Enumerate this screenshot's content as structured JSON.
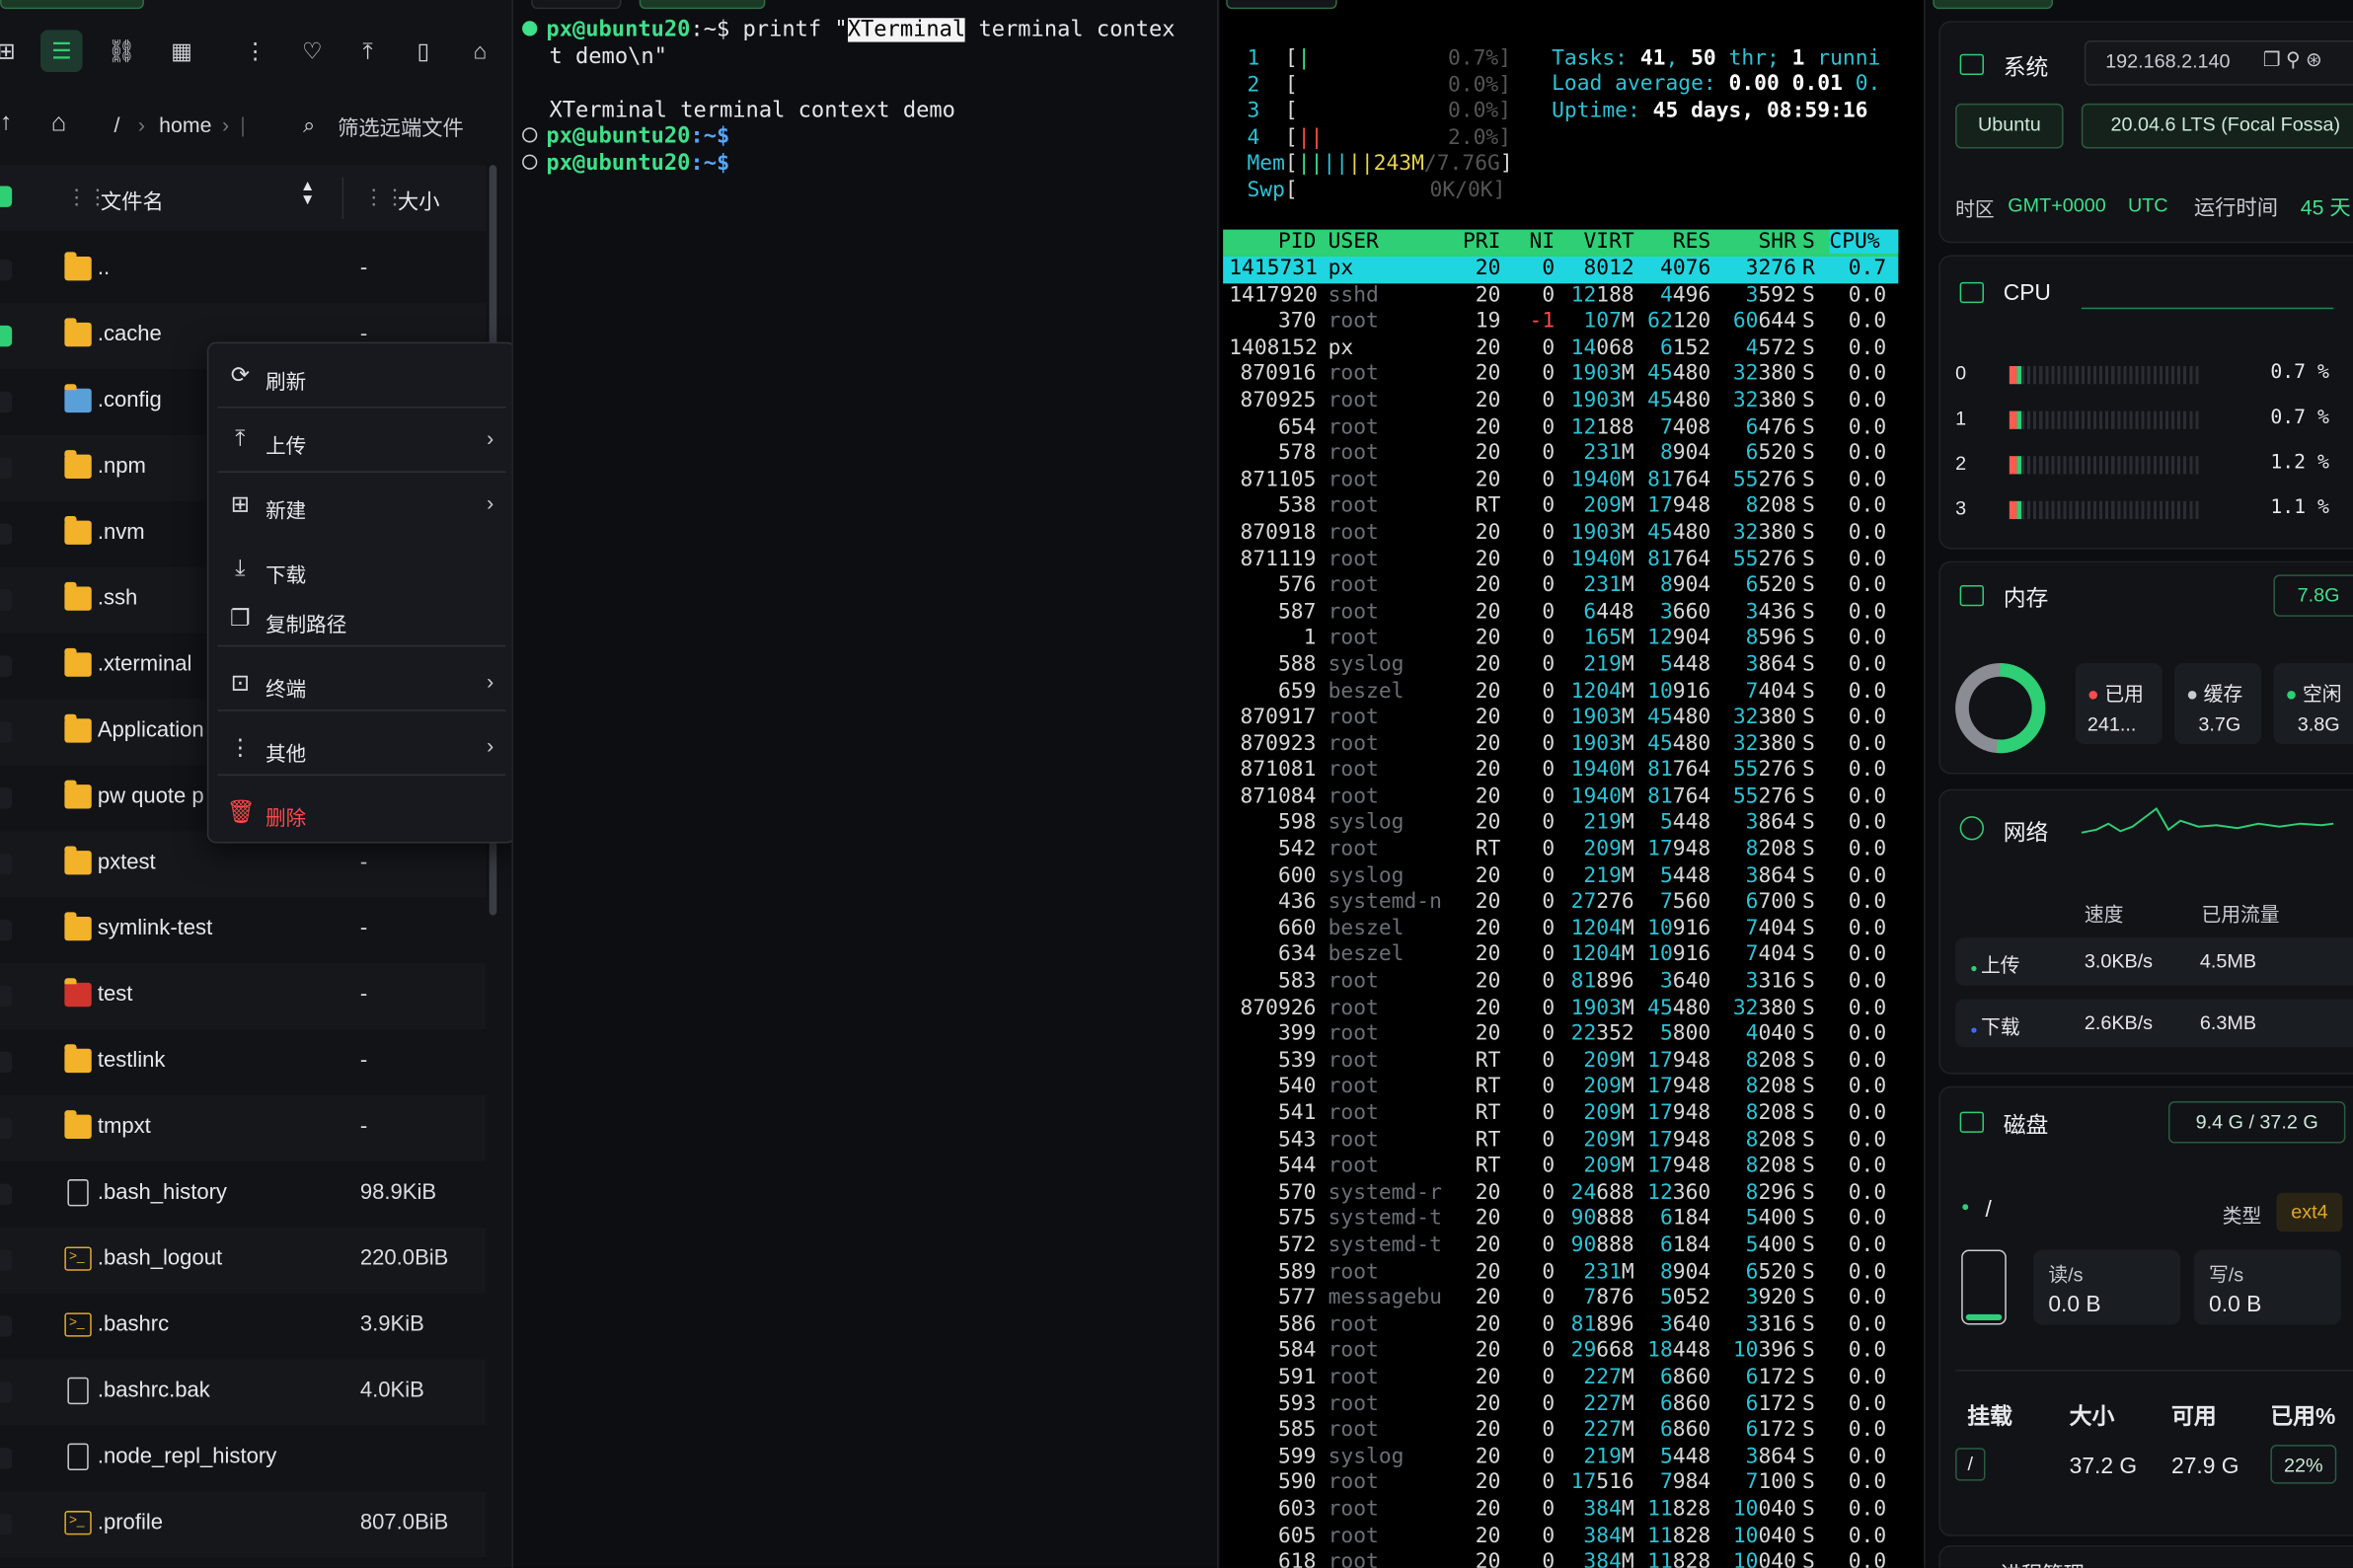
{
  "file_pane": {
    "path": {
      "sep": "/",
      "home": "home",
      "filter_placeholder": "筛选远端文件"
    },
    "columns": {
      "name": "文件名",
      "size": "大小"
    },
    "rows": [
      {
        "name": "..",
        "size": "-",
        "type": "folder",
        "checked": false
      },
      {
        "name": ".cache",
        "size": "-",
        "type": "folder",
        "checked": true
      },
      {
        "name": ".config",
        "size": "",
        "type": "gear-folder",
        "checked": false
      },
      {
        "name": ".npm",
        "size": "",
        "type": "folder",
        "checked": false
      },
      {
        "name": ".nvm",
        "size": "",
        "type": "folder",
        "checked": false
      },
      {
        "name": ".ssh",
        "size": "",
        "type": "folder",
        "checked": false
      },
      {
        "name": ".xterminal",
        "size": "",
        "type": "folder",
        "checked": false
      },
      {
        "name": "Application",
        "size": "",
        "type": "folder",
        "checked": false
      },
      {
        "name": "pw quote p",
        "size": "",
        "type": "folder",
        "checked": false
      },
      {
        "name": "pxtest",
        "size": "-",
        "type": "folder",
        "checked": false
      },
      {
        "name": "symlink-test",
        "size": "-",
        "type": "folder",
        "checked": false
      },
      {
        "name": "test",
        "size": "-",
        "type": "special",
        "checked": false
      },
      {
        "name": "testlink",
        "size": "-",
        "type": "folder",
        "checked": false
      },
      {
        "name": "tmpxt",
        "size": "-",
        "type": "folder",
        "checked": false
      },
      {
        "name": ".bash_history",
        "size": "98.9KiB",
        "type": "file",
        "checked": false
      },
      {
        "name": ".bash_logout",
        "size": "220.0BiB",
        "type": "terminal",
        "checked": false
      },
      {
        "name": ".bashrc",
        "size": "3.9KiB",
        "type": "terminal",
        "checked": false
      },
      {
        "name": ".bashrc.bak",
        "size": "4.0KiB",
        "type": "file",
        "checked": false
      },
      {
        "name": ".node_repl_history",
        "size": "",
        "type": "file",
        "checked": false
      },
      {
        "name": ".profile",
        "size": "807.0BiB",
        "type": "terminal",
        "checked": false
      }
    ],
    "context_menu": [
      {
        "label": "刷新",
        "icon": "refresh-icon",
        "glyph": "⟳",
        "arrow": false
      },
      {
        "label": "上传",
        "icon": "upload-icon",
        "glyph": "⤒",
        "arrow": true
      },
      {
        "label": "新建",
        "icon": "new-file-icon",
        "glyph": "⊞",
        "arrow": true
      },
      {
        "label": "下载",
        "icon": "download-icon",
        "glyph": "⤓",
        "arrow": false
      },
      {
        "label": "复制路径",
        "icon": "copy-icon",
        "glyph": "❐",
        "arrow": false
      },
      {
        "label": "终端",
        "icon": "terminal-icon",
        "glyph": "⊡",
        "arrow": true
      },
      {
        "label": "其他",
        "icon": "more-icon",
        "glyph": "⋮",
        "arrow": true
      },
      {
        "label": "删除",
        "icon": "trash-icon",
        "glyph": "🗑",
        "arrow": false,
        "danger": true
      }
    ]
  },
  "terminal": {
    "user": "px@ubuntu20",
    "cmd_line1_pre": ":~$ printf \"",
    "cmd_highlight": "XTerminal",
    "cmd_line1_post": " terminal contex",
    "cmd_line2": "t demo\\n\"",
    "output": "XTerminal terminal context demo",
    "prompt_tail": ":~$"
  },
  "htop": {
    "cpus": [
      {
        "n": "1",
        "bar": "|",
        "pct": "0.7%]"
      },
      {
        "n": "2",
        "bar": "",
        "pct": "0.0%]"
      },
      {
        "n": "3",
        "bar": "",
        "pct": "0.0%]"
      },
      {
        "n": "4",
        "bar": "||",
        "pct": "2.0%]"
      }
    ],
    "mem": "Mem[||||243M/7.76G]",
    "mem_used": "243M",
    "mem_total": "7.76G",
    "swp": "0K/0K]",
    "tasks_label": "Tasks: ",
    "tasks": "41",
    "thr_sep": ", ",
    "thr": "50",
    "thr_label": " thr; ",
    "running": "1",
    "running_label": " runni",
    "load_label": "Load average: ",
    "load1": "0.00",
    "load5": "0.01",
    "load15": "0.",
    "uptime_label": "Uptime: ",
    "uptime": "45 days, 08:59:16",
    "headers": [
      "PID",
      "USER",
      "PRI",
      "NI",
      "VIRT",
      "RES",
      "SHR",
      "S",
      "CPU%"
    ],
    "procs": [
      [
        "1415731",
        "px",
        "20",
        "0",
        "8012",
        "4076",
        "3276",
        "R",
        "0.7"
      ],
      [
        "1417920",
        "sshd",
        "20",
        "0",
        "12188",
        "4496",
        "3592",
        "S",
        "0.0"
      ],
      [
        "370",
        "root",
        "19",
        "-1",
        "107M",
        "62120",
        "60644",
        "S",
        "0.0"
      ],
      [
        "1408152",
        "px",
        "20",
        "0",
        "14068",
        "6152",
        "4572",
        "S",
        "0.0"
      ],
      [
        "870916",
        "root",
        "20",
        "0",
        "1903M",
        "45480",
        "32380",
        "S",
        "0.0"
      ],
      [
        "870925",
        "root",
        "20",
        "0",
        "1903M",
        "45480",
        "32380",
        "S",
        "0.0"
      ],
      [
        "654",
        "root",
        "20",
        "0",
        "12188",
        "7408",
        "6476",
        "S",
        "0.0"
      ],
      [
        "578",
        "root",
        "20",
        "0",
        "231M",
        "8904",
        "6520",
        "S",
        "0.0"
      ],
      [
        "871105",
        "root",
        "20",
        "0",
        "1940M",
        "81764",
        "55276",
        "S",
        "0.0"
      ],
      [
        "538",
        "root",
        "RT",
        "0",
        "209M",
        "17948",
        "8208",
        "S",
        "0.0"
      ],
      [
        "870918",
        "root",
        "20",
        "0",
        "1903M",
        "45480",
        "32380",
        "S",
        "0.0"
      ],
      [
        "871119",
        "root",
        "20",
        "0",
        "1940M",
        "81764",
        "55276",
        "S",
        "0.0"
      ],
      [
        "576",
        "root",
        "20",
        "0",
        "231M",
        "8904",
        "6520",
        "S",
        "0.0"
      ],
      [
        "587",
        "root",
        "20",
        "0",
        "6448",
        "3660",
        "3436",
        "S",
        "0.0"
      ],
      [
        "1",
        "root",
        "20",
        "0",
        "165M",
        "12904",
        "8596",
        "S",
        "0.0"
      ],
      [
        "588",
        "syslog",
        "20",
        "0",
        "219M",
        "5448",
        "3864",
        "S",
        "0.0"
      ],
      [
        "659",
        "beszel",
        "20",
        "0",
        "1204M",
        "10916",
        "7404",
        "S",
        "0.0"
      ],
      [
        "870917",
        "root",
        "20",
        "0",
        "1903M",
        "45480",
        "32380",
        "S",
        "0.0"
      ],
      [
        "870923",
        "root",
        "20",
        "0",
        "1903M",
        "45480",
        "32380",
        "S",
        "0.0"
      ],
      [
        "871081",
        "root",
        "20",
        "0",
        "1940M",
        "81764",
        "55276",
        "S",
        "0.0"
      ],
      [
        "871084",
        "root",
        "20",
        "0",
        "1940M",
        "81764",
        "55276",
        "S",
        "0.0"
      ],
      [
        "598",
        "syslog",
        "20",
        "0",
        "219M",
        "5448",
        "3864",
        "S",
        "0.0"
      ],
      [
        "542",
        "root",
        "RT",
        "0",
        "209M",
        "17948",
        "8208",
        "S",
        "0.0"
      ],
      [
        "600",
        "syslog",
        "20",
        "0",
        "219M",
        "5448",
        "3864",
        "S",
        "0.0"
      ],
      [
        "436",
        "systemd-n",
        "20",
        "0",
        "27276",
        "7560",
        "6700",
        "S",
        "0.0"
      ],
      [
        "660",
        "beszel",
        "20",
        "0",
        "1204M",
        "10916",
        "7404",
        "S",
        "0.0"
      ],
      [
        "634",
        "beszel",
        "20",
        "0",
        "1204M",
        "10916",
        "7404",
        "S",
        "0.0"
      ],
      [
        "583",
        "root",
        "20",
        "0",
        "81896",
        "3640",
        "3316",
        "S",
        "0.0"
      ],
      [
        "870926",
        "root",
        "20",
        "0",
        "1903M",
        "45480",
        "32380",
        "S",
        "0.0"
      ],
      [
        "399",
        "root",
        "20",
        "0",
        "22352",
        "5800",
        "4040",
        "S",
        "0.0"
      ],
      [
        "539",
        "root",
        "RT",
        "0",
        "209M",
        "17948",
        "8208",
        "S",
        "0.0"
      ],
      [
        "540",
        "root",
        "RT",
        "0",
        "209M",
        "17948",
        "8208",
        "S",
        "0.0"
      ],
      [
        "541",
        "root",
        "RT",
        "0",
        "209M",
        "17948",
        "8208",
        "S",
        "0.0"
      ],
      [
        "543",
        "root",
        "RT",
        "0",
        "209M",
        "17948",
        "8208",
        "S",
        "0.0"
      ],
      [
        "544",
        "root",
        "RT",
        "0",
        "209M",
        "17948",
        "8208",
        "S",
        "0.0"
      ],
      [
        "570",
        "systemd-r",
        "20",
        "0",
        "24688",
        "12360",
        "8296",
        "S",
        "0.0"
      ],
      [
        "575",
        "systemd-t",
        "20",
        "0",
        "90888",
        "6184",
        "5400",
        "S",
        "0.0"
      ],
      [
        "572",
        "systemd-t",
        "20",
        "0",
        "90888",
        "6184",
        "5400",
        "S",
        "0.0"
      ],
      [
        "589",
        "root",
        "20",
        "0",
        "231M",
        "8904",
        "6520",
        "S",
        "0.0"
      ],
      [
        "577",
        "messagebu",
        "20",
        "0",
        "7876",
        "5052",
        "3920",
        "S",
        "0.0"
      ],
      [
        "586",
        "root",
        "20",
        "0",
        "81896",
        "3640",
        "3316",
        "S",
        "0.0"
      ],
      [
        "584",
        "root",
        "20",
        "0",
        "29668",
        "18448",
        "10396",
        "S",
        "0.0"
      ],
      [
        "591",
        "root",
        "20",
        "0",
        "227M",
        "6860",
        "6172",
        "S",
        "0.0"
      ],
      [
        "593",
        "root",
        "20",
        "0",
        "227M",
        "6860",
        "6172",
        "S",
        "0.0"
      ],
      [
        "585",
        "root",
        "20",
        "0",
        "227M",
        "6860",
        "6172",
        "S",
        "0.0"
      ],
      [
        "599",
        "syslog",
        "20",
        "0",
        "219M",
        "5448",
        "3864",
        "S",
        "0.0"
      ],
      [
        "590",
        "root",
        "20",
        "0",
        "17516",
        "7984",
        "7100",
        "S",
        "0.0"
      ],
      [
        "603",
        "root",
        "20",
        "0",
        "384M",
        "11828",
        "10040",
        "S",
        "0.0"
      ],
      [
        "605",
        "root",
        "20",
        "0",
        "384M",
        "11828",
        "10040",
        "S",
        "0.0"
      ],
      [
        "618",
        "root",
        "20",
        "0",
        "384M",
        "11828",
        "10040",
        "S",
        "0.0"
      ]
    ]
  },
  "monitor": {
    "system": {
      "title": "系统",
      "ip": "192.168.2.140",
      "os": "Ubuntu",
      "version": "20.04.6 LTS (Focal Fossa)",
      "tz_label": "时区",
      "tz": "GMT+0000",
      "tz_name": "UTC",
      "uptime_label": "运行时间",
      "uptime": "45 天"
    },
    "cpu": {
      "title": "CPU",
      "cores": [
        {
          "id": "0",
          "pct": "0.7 %"
        },
        {
          "id": "1",
          "pct": "0.7 %"
        },
        {
          "id": "2",
          "pct": "1.2 %"
        },
        {
          "id": "3",
          "pct": "1.1 %"
        }
      ]
    },
    "memory": {
      "title": "内存",
      "total": "7.8G",
      "used_label": "已用",
      "used": "241...",
      "cache_label": "缓存",
      "cache": "3.7G",
      "free_label": "空闲",
      "free": "3.8G"
    },
    "network": {
      "title": "网络",
      "speed_label": "速度",
      "traffic_label": "已用流量",
      "up_label": "上传",
      "up_speed": "3.0KB/s",
      "up_total": "4.5MB",
      "down_label": "下载",
      "down_speed": "2.6KB/s",
      "down_total": "6.3MB"
    },
    "disk": {
      "title": "磁盘",
      "summary": "9.4 G / 37.2 G",
      "mount": "/",
      "type_label": "类型",
      "type": "ext4",
      "read_label": "读/s",
      "read": "0.0 B",
      "write_label": "写/s",
      "write": "0.0 B",
      "table_headers": [
        "挂载",
        "大小",
        "可用",
        "已用%"
      ],
      "row": {
        "mount": "/",
        "size": "37.2 G",
        "avail": "27.9 G",
        "used": "22%"
      }
    },
    "process_title": "进程管理"
  }
}
